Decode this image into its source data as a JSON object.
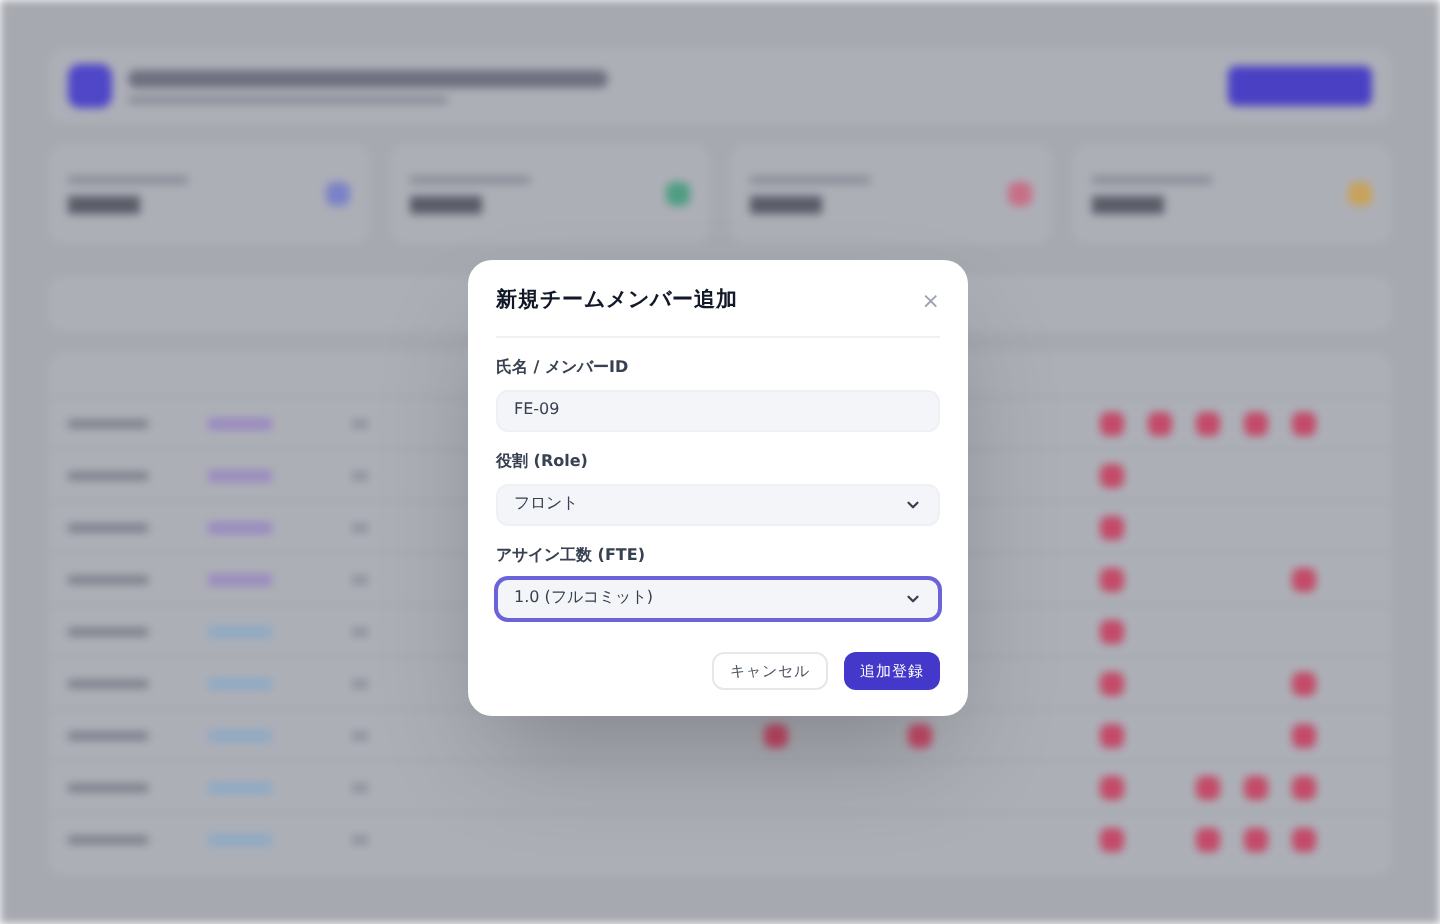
{
  "dialog": {
    "title": "新規チームメンバー追加",
    "close": "×",
    "fields": [
      {
        "kind": "text",
        "label": "氏名 / メンバーID",
        "value": "FE-09",
        "focused": false
      },
      {
        "kind": "select",
        "label": "役割 (Role)",
        "value": "フロント",
        "focused": false
      },
      {
        "kind": "select",
        "label": "アサイン工数 (FTE)",
        "value": "1.0 (フルコミット)",
        "focused": true
      }
    ],
    "buttons": [
      {
        "kind": "secondary",
        "label": "キャンセル"
      },
      {
        "kind": "primary",
        "label": "追加登録"
      }
    ]
  }
}
